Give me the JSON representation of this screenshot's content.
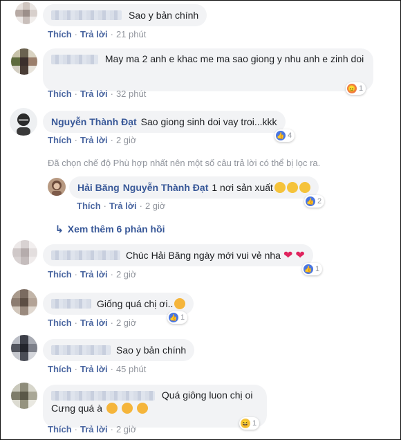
{
  "actions": {
    "like": "Thích",
    "reply": "Trả lời"
  },
  "comments": [
    {
      "text": "Sao y bản chính",
      "time": "21 phút"
    },
    {
      "text": "May ma 2 anh e khac me ma sao giong y nhu anh e zinh doi",
      "time": "32 phút",
      "reaction": {
        "type": "angry-icon",
        "count": "1"
      }
    },
    {
      "author": "Nguyễn Thành Đạt",
      "text": "Sao giong sinh doi vay troi...kkk",
      "time": "2 giờ",
      "reaction": {
        "type": "like-icon",
        "count": "4"
      }
    },
    {
      "author": "Chúc Hải Băng ngày mới vui vẻ nha",
      "time": "2 giờ",
      "reaction": {
        "type": "like-icon",
        "count": "1"
      }
    },
    {
      "text": "Giống quá chị ơi..",
      "time": "2 giờ",
      "reaction": {
        "type": "like-icon",
        "count": "1"
      }
    },
    {
      "text": "Sao y bản chính",
      "time": "45 phút"
    },
    {
      "text_line1": "Quá giông luon chị oi",
      "text_line2": "Cưng quá à",
      "time": "2 giờ",
      "reaction": {
        "type": "haha-icon",
        "count": "1"
      }
    }
  ],
  "filter_note": "Đã chọn chế độ Phù hợp nhất nên một số câu trả lời có thể bị lọc ra.",
  "reply": {
    "author": "Hải Băng",
    "mention": "Nguyễn Thành Đạt",
    "text": "1 nơi sản xuất",
    "time": "2 giờ",
    "reaction_count": "2"
  },
  "see_more": "Xem thêm 6 phản hồi",
  "colors": {
    "link": "#385898",
    "bubble": "#f2f3f5",
    "meta": "#90949c",
    "like": "#4a76e0"
  }
}
